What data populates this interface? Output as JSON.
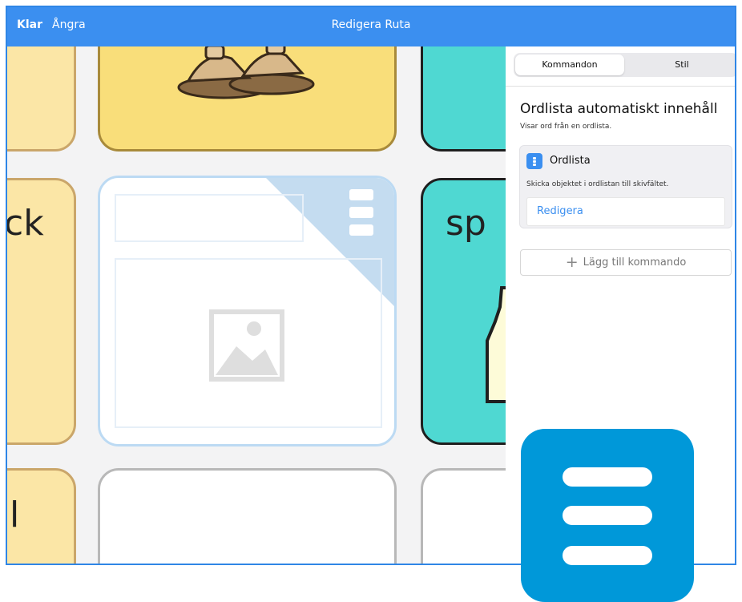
{
  "topbar": {
    "done": "Klar",
    "undo": "Ångra",
    "title": "Redigera Ruta"
  },
  "grid": {
    "tile_texts": [
      "ck",
      "sp",
      "l"
    ]
  },
  "panel": {
    "tabs": [
      {
        "label": "Kommandon",
        "selected": true
      },
      {
        "label": "Stil",
        "selected": false
      }
    ],
    "heading": "Ordlista automatiskt innehåll",
    "subheading": "Visar ord från en ordlista.",
    "command": {
      "name": "Ordlista",
      "description": "Skicka objektet i ordlistan till skivfältet.",
      "edit_label": "Redigera"
    },
    "add_command": "Lägg till kommando"
  },
  "colors": {
    "accent": "#3b8ff0",
    "app_icon": "#0098d9",
    "yellow_tile": "#f9de7a",
    "teal_tile": "#4fd8d2"
  }
}
